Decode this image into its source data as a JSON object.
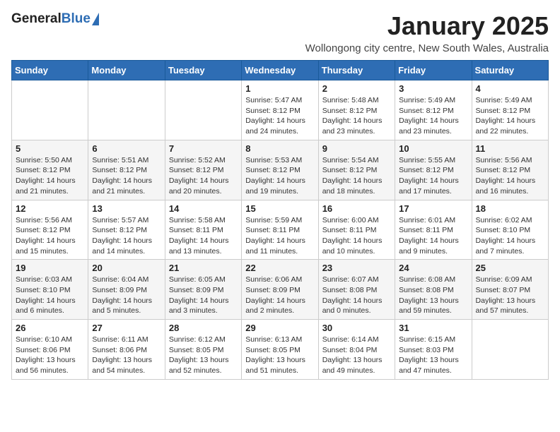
{
  "header": {
    "logo_general": "General",
    "logo_blue": "Blue",
    "month_title": "January 2025",
    "location": "Wollongong city centre, New South Wales, Australia"
  },
  "days_of_week": [
    "Sunday",
    "Monday",
    "Tuesday",
    "Wednesday",
    "Thursday",
    "Friday",
    "Saturday"
  ],
  "weeks": [
    [
      {
        "day": "",
        "info": ""
      },
      {
        "day": "",
        "info": ""
      },
      {
        "day": "",
        "info": ""
      },
      {
        "day": "1",
        "info": "Sunrise: 5:47 AM\nSunset: 8:12 PM\nDaylight: 14 hours\nand 24 minutes."
      },
      {
        "day": "2",
        "info": "Sunrise: 5:48 AM\nSunset: 8:12 PM\nDaylight: 14 hours\nand 23 minutes."
      },
      {
        "day": "3",
        "info": "Sunrise: 5:49 AM\nSunset: 8:12 PM\nDaylight: 14 hours\nand 23 minutes."
      },
      {
        "day": "4",
        "info": "Sunrise: 5:49 AM\nSunset: 8:12 PM\nDaylight: 14 hours\nand 22 minutes."
      }
    ],
    [
      {
        "day": "5",
        "info": "Sunrise: 5:50 AM\nSunset: 8:12 PM\nDaylight: 14 hours\nand 21 minutes."
      },
      {
        "day": "6",
        "info": "Sunrise: 5:51 AM\nSunset: 8:12 PM\nDaylight: 14 hours\nand 21 minutes."
      },
      {
        "day": "7",
        "info": "Sunrise: 5:52 AM\nSunset: 8:12 PM\nDaylight: 14 hours\nand 20 minutes."
      },
      {
        "day": "8",
        "info": "Sunrise: 5:53 AM\nSunset: 8:12 PM\nDaylight: 14 hours\nand 19 minutes."
      },
      {
        "day": "9",
        "info": "Sunrise: 5:54 AM\nSunset: 8:12 PM\nDaylight: 14 hours\nand 18 minutes."
      },
      {
        "day": "10",
        "info": "Sunrise: 5:55 AM\nSunset: 8:12 PM\nDaylight: 14 hours\nand 17 minutes."
      },
      {
        "day": "11",
        "info": "Sunrise: 5:56 AM\nSunset: 8:12 PM\nDaylight: 14 hours\nand 16 minutes."
      }
    ],
    [
      {
        "day": "12",
        "info": "Sunrise: 5:56 AM\nSunset: 8:12 PM\nDaylight: 14 hours\nand 15 minutes."
      },
      {
        "day": "13",
        "info": "Sunrise: 5:57 AM\nSunset: 8:12 PM\nDaylight: 14 hours\nand 14 minutes."
      },
      {
        "day": "14",
        "info": "Sunrise: 5:58 AM\nSunset: 8:11 PM\nDaylight: 14 hours\nand 13 minutes."
      },
      {
        "day": "15",
        "info": "Sunrise: 5:59 AM\nSunset: 8:11 PM\nDaylight: 14 hours\nand 11 minutes."
      },
      {
        "day": "16",
        "info": "Sunrise: 6:00 AM\nSunset: 8:11 PM\nDaylight: 14 hours\nand 10 minutes."
      },
      {
        "day": "17",
        "info": "Sunrise: 6:01 AM\nSunset: 8:11 PM\nDaylight: 14 hours\nand 9 minutes."
      },
      {
        "day": "18",
        "info": "Sunrise: 6:02 AM\nSunset: 8:10 PM\nDaylight: 14 hours\nand 7 minutes."
      }
    ],
    [
      {
        "day": "19",
        "info": "Sunrise: 6:03 AM\nSunset: 8:10 PM\nDaylight: 14 hours\nand 6 minutes."
      },
      {
        "day": "20",
        "info": "Sunrise: 6:04 AM\nSunset: 8:09 PM\nDaylight: 14 hours\nand 5 minutes."
      },
      {
        "day": "21",
        "info": "Sunrise: 6:05 AM\nSunset: 8:09 PM\nDaylight: 14 hours\nand 3 minutes."
      },
      {
        "day": "22",
        "info": "Sunrise: 6:06 AM\nSunset: 8:09 PM\nDaylight: 14 hours\nand 2 minutes."
      },
      {
        "day": "23",
        "info": "Sunrise: 6:07 AM\nSunset: 8:08 PM\nDaylight: 14 hours\nand 0 minutes."
      },
      {
        "day": "24",
        "info": "Sunrise: 6:08 AM\nSunset: 8:08 PM\nDaylight: 13 hours\nand 59 minutes."
      },
      {
        "day": "25",
        "info": "Sunrise: 6:09 AM\nSunset: 8:07 PM\nDaylight: 13 hours\nand 57 minutes."
      }
    ],
    [
      {
        "day": "26",
        "info": "Sunrise: 6:10 AM\nSunset: 8:06 PM\nDaylight: 13 hours\nand 56 minutes."
      },
      {
        "day": "27",
        "info": "Sunrise: 6:11 AM\nSunset: 8:06 PM\nDaylight: 13 hours\nand 54 minutes."
      },
      {
        "day": "28",
        "info": "Sunrise: 6:12 AM\nSunset: 8:05 PM\nDaylight: 13 hours\nand 52 minutes."
      },
      {
        "day": "29",
        "info": "Sunrise: 6:13 AM\nSunset: 8:05 PM\nDaylight: 13 hours\nand 51 minutes."
      },
      {
        "day": "30",
        "info": "Sunrise: 6:14 AM\nSunset: 8:04 PM\nDaylight: 13 hours\nand 49 minutes."
      },
      {
        "day": "31",
        "info": "Sunrise: 6:15 AM\nSunset: 8:03 PM\nDaylight: 13 hours\nand 47 minutes."
      },
      {
        "day": "",
        "info": ""
      }
    ]
  ]
}
